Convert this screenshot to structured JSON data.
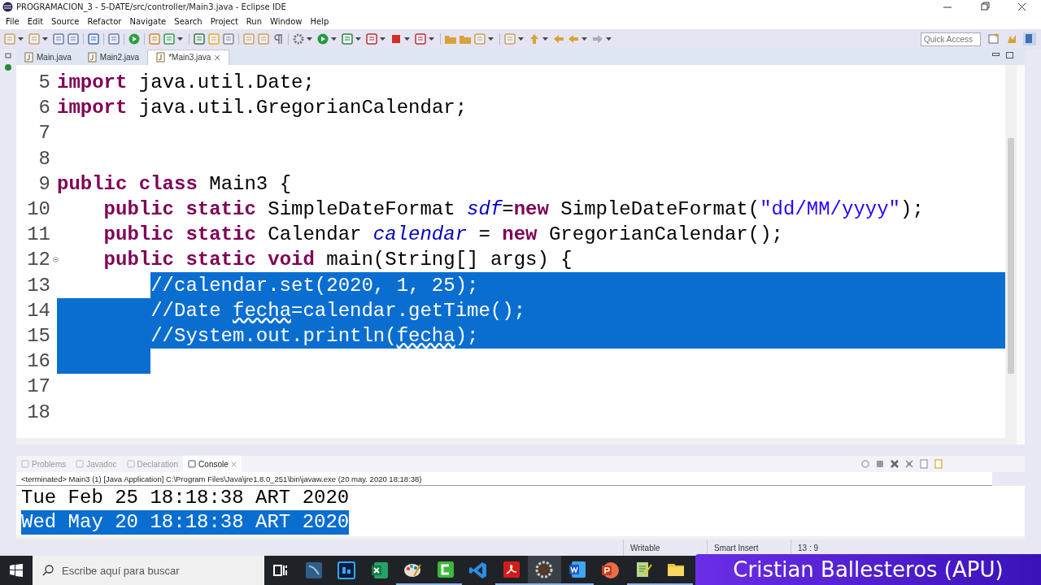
{
  "window": {
    "title": "PROGRAMACION_3 - 5-DATE/src/controller/Main3.java - Eclipse IDE"
  },
  "menu": [
    "File",
    "Edit",
    "Source",
    "Refactor",
    "Navigate",
    "Search",
    "Project",
    "Run",
    "Window",
    "Help"
  ],
  "quick_access": {
    "placeholder": "Quick Access"
  },
  "editor": {
    "tabs": [
      {
        "label": "Main.java",
        "selected": false
      },
      {
        "label": "Main2.java",
        "selected": false
      },
      {
        "label": "*Main3.java",
        "selected": true
      }
    ],
    "lines": [
      {
        "number": "5",
        "selected": false,
        "tokens": [
          {
            "text": "import",
            "kind": "keyword"
          },
          {
            "text": " java.util.Date;",
            "kind": "plain"
          }
        ]
      },
      {
        "number": "6",
        "selected": false,
        "tokens": [
          {
            "text": "import",
            "kind": "keyword"
          },
          {
            "text": " java.util.GregorianCalendar;",
            "kind": "plain"
          }
        ]
      },
      {
        "number": "7",
        "selected": false
      },
      {
        "number": "8",
        "selected": false
      },
      {
        "number": "9",
        "selected": false,
        "tokens": [
          {
            "text": "public class",
            "kind": "keyword"
          },
          {
            "text": " Main3 {",
            "kind": "plain"
          }
        ],
        "children": [
          {
            "number": "10",
            "selected": false,
            "tokens": [
              {
                "text": "public static",
                "kind": "keyword"
              },
              {
                "text": " SimpleDateFormat ",
                "kind": "plain"
              },
              {
                "text": "sdf",
                "kind": "field"
              },
              {
                "text": "=",
                "kind": "plain"
              },
              {
                "text": "new",
                "kind": "keyword"
              },
              {
                "text": " SimpleDateFormat(",
                "kind": "plain"
              },
              {
                "text": "\"dd/MM/yyyy\"",
                "kind": "string"
              },
              {
                "text": ");",
                "kind": "plain"
              }
            ]
          },
          {
            "number": "11",
            "selected": false,
            "tokens": [
              {
                "text": "public static",
                "kind": "keyword"
              },
              {
                "text": " Calendar ",
                "kind": "plain"
              },
              {
                "text": "calendar",
                "kind": "field"
              },
              {
                "text": " = ",
                "kind": "plain"
              },
              {
                "text": "new",
                "kind": "keyword"
              },
              {
                "text": " GregorianCalendar();",
                "kind": "plain"
              }
            ]
          },
          {
            "number": "12",
            "selected": false,
            "expanded": true,
            "tokens": [
              {
                "text": "public static void",
                "kind": "keyword"
              },
              {
                "text": " main(String[] args) {",
                "kind": "plain"
              }
            ],
            "children": [
              {
                "number": "13",
                "selected": true,
                "tokens": [
                  {
                    "text": "//calendar.set(2020, 1, 25);",
                    "kind": "comment"
                  }
                ]
              },
              {
                "number": "14",
                "selected": true,
                "tokens": [
                  {
                    "text": "//Date ",
                    "kind": "comment"
                  },
                  {
                    "text": "fecha",
                    "kind": "misspelled"
                  },
                  {
                    "text": "=calendar.getTime();",
                    "kind": "comment"
                  }
                ]
              },
              {
                "number": "15",
                "selected": true,
                "tokens": [
                  {
                    "text": "//System.out.println(",
                    "kind": "comment"
                  },
                  {
                    "text": "fecha",
                    "kind": "misspelled"
                  },
                  {
                    "text": ");",
                    "kind": "comment"
                  }
                ]
              },
              {
                "number": "16",
                "selected": true
              },
              {
                "number": "17",
                "selected": false
              },
              {
                "number": "18",
                "selected": false
              }
            ]
          }
        ]
      }
    ]
  },
  "panel": {
    "tabs": [
      {
        "label": "Problems",
        "selected": false
      },
      {
        "label": "Javadoc",
        "selected": false
      },
      {
        "label": "Declaration",
        "selected": false
      },
      {
        "label": "Console",
        "selected": true
      }
    ],
    "process": "<terminated> Main3 (1) [Java Application] C:\\Program Files\\Java\\jre1.8.0_251\\bin\\javaw.exe (20 may. 2020 18:18:38)",
    "output": [
      {
        "text": "Tue Feb 25 18:18:38 ART 2020",
        "selected": false
      },
      {
        "text": "Wed May 20 18:18:38 ART 2020",
        "selected": true
      }
    ]
  },
  "status_bar": [
    "Writable",
    "Smart Insert",
    "13 : 9"
  ],
  "taskbar": {
    "search": {
      "placeholder": "Escribe aquí para buscar"
    },
    "apps": [
      {
        "kind": "taskview",
        "running": false,
        "active": false
      },
      {
        "kind": "dbtool",
        "running": false,
        "active": false
      },
      {
        "kind": "photoshop",
        "running": false,
        "active": false
      },
      {
        "kind": "excel",
        "running": false,
        "active": false
      },
      {
        "kind": "paint",
        "running": true,
        "active": false
      },
      {
        "kind": "camtasia",
        "running": true,
        "active": false
      },
      {
        "kind": "vscode",
        "running": false,
        "active": false
      },
      {
        "kind": "acrobat",
        "running": true,
        "active": false
      },
      {
        "kind": "eclipse",
        "running": true,
        "active": true
      },
      {
        "kind": "word",
        "running": true,
        "active": false
      },
      {
        "kind": "powerpoint",
        "running": false,
        "active": false
      },
      {
        "kind": "notepad",
        "running": true,
        "active": false
      },
      {
        "kind": "explorer",
        "running": true,
        "active": false
      }
    ]
  },
  "banner": {
    "text": "Cristian Ballesteros (APU)"
  }
}
